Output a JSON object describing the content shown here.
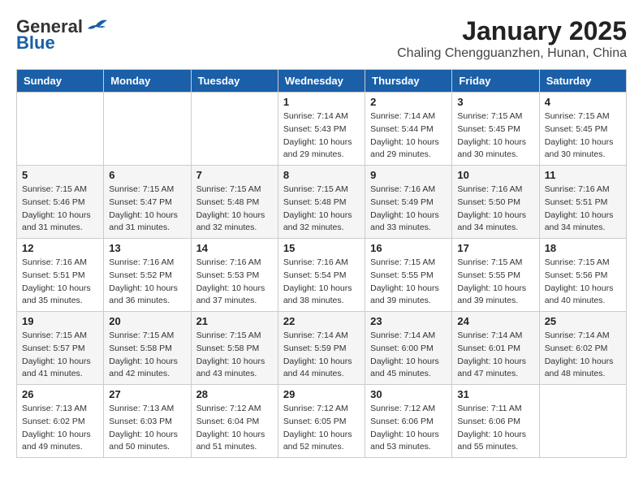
{
  "header": {
    "logo_general": "General",
    "logo_blue": "Blue",
    "title": "January 2025",
    "subtitle": "Chaling Chengguanzhen, Hunan, China"
  },
  "weekdays": [
    "Sunday",
    "Monday",
    "Tuesday",
    "Wednesday",
    "Thursday",
    "Friday",
    "Saturday"
  ],
  "weeks": [
    [
      {
        "day": "",
        "info": ""
      },
      {
        "day": "",
        "info": ""
      },
      {
        "day": "",
        "info": ""
      },
      {
        "day": "1",
        "info": "Sunrise: 7:14 AM\nSunset: 5:43 PM\nDaylight: 10 hours\nand 29 minutes."
      },
      {
        "day": "2",
        "info": "Sunrise: 7:14 AM\nSunset: 5:44 PM\nDaylight: 10 hours\nand 29 minutes."
      },
      {
        "day": "3",
        "info": "Sunrise: 7:15 AM\nSunset: 5:45 PM\nDaylight: 10 hours\nand 30 minutes."
      },
      {
        "day": "4",
        "info": "Sunrise: 7:15 AM\nSunset: 5:45 PM\nDaylight: 10 hours\nand 30 minutes."
      }
    ],
    [
      {
        "day": "5",
        "info": "Sunrise: 7:15 AM\nSunset: 5:46 PM\nDaylight: 10 hours\nand 31 minutes."
      },
      {
        "day": "6",
        "info": "Sunrise: 7:15 AM\nSunset: 5:47 PM\nDaylight: 10 hours\nand 31 minutes."
      },
      {
        "day": "7",
        "info": "Sunrise: 7:15 AM\nSunset: 5:48 PM\nDaylight: 10 hours\nand 32 minutes."
      },
      {
        "day": "8",
        "info": "Sunrise: 7:15 AM\nSunset: 5:48 PM\nDaylight: 10 hours\nand 32 minutes."
      },
      {
        "day": "9",
        "info": "Sunrise: 7:16 AM\nSunset: 5:49 PM\nDaylight: 10 hours\nand 33 minutes."
      },
      {
        "day": "10",
        "info": "Sunrise: 7:16 AM\nSunset: 5:50 PM\nDaylight: 10 hours\nand 34 minutes."
      },
      {
        "day": "11",
        "info": "Sunrise: 7:16 AM\nSunset: 5:51 PM\nDaylight: 10 hours\nand 34 minutes."
      }
    ],
    [
      {
        "day": "12",
        "info": "Sunrise: 7:16 AM\nSunset: 5:51 PM\nDaylight: 10 hours\nand 35 minutes."
      },
      {
        "day": "13",
        "info": "Sunrise: 7:16 AM\nSunset: 5:52 PM\nDaylight: 10 hours\nand 36 minutes."
      },
      {
        "day": "14",
        "info": "Sunrise: 7:16 AM\nSunset: 5:53 PM\nDaylight: 10 hours\nand 37 minutes."
      },
      {
        "day": "15",
        "info": "Sunrise: 7:16 AM\nSunset: 5:54 PM\nDaylight: 10 hours\nand 38 minutes."
      },
      {
        "day": "16",
        "info": "Sunrise: 7:15 AM\nSunset: 5:55 PM\nDaylight: 10 hours\nand 39 minutes."
      },
      {
        "day": "17",
        "info": "Sunrise: 7:15 AM\nSunset: 5:55 PM\nDaylight: 10 hours\nand 39 minutes."
      },
      {
        "day": "18",
        "info": "Sunrise: 7:15 AM\nSunset: 5:56 PM\nDaylight: 10 hours\nand 40 minutes."
      }
    ],
    [
      {
        "day": "19",
        "info": "Sunrise: 7:15 AM\nSunset: 5:57 PM\nDaylight: 10 hours\nand 41 minutes."
      },
      {
        "day": "20",
        "info": "Sunrise: 7:15 AM\nSunset: 5:58 PM\nDaylight: 10 hours\nand 42 minutes."
      },
      {
        "day": "21",
        "info": "Sunrise: 7:15 AM\nSunset: 5:58 PM\nDaylight: 10 hours\nand 43 minutes."
      },
      {
        "day": "22",
        "info": "Sunrise: 7:14 AM\nSunset: 5:59 PM\nDaylight: 10 hours\nand 44 minutes."
      },
      {
        "day": "23",
        "info": "Sunrise: 7:14 AM\nSunset: 6:00 PM\nDaylight: 10 hours\nand 45 minutes."
      },
      {
        "day": "24",
        "info": "Sunrise: 7:14 AM\nSunset: 6:01 PM\nDaylight: 10 hours\nand 47 minutes."
      },
      {
        "day": "25",
        "info": "Sunrise: 7:14 AM\nSunset: 6:02 PM\nDaylight: 10 hours\nand 48 minutes."
      }
    ],
    [
      {
        "day": "26",
        "info": "Sunrise: 7:13 AM\nSunset: 6:02 PM\nDaylight: 10 hours\nand 49 minutes."
      },
      {
        "day": "27",
        "info": "Sunrise: 7:13 AM\nSunset: 6:03 PM\nDaylight: 10 hours\nand 50 minutes."
      },
      {
        "day": "28",
        "info": "Sunrise: 7:12 AM\nSunset: 6:04 PM\nDaylight: 10 hours\nand 51 minutes."
      },
      {
        "day": "29",
        "info": "Sunrise: 7:12 AM\nSunset: 6:05 PM\nDaylight: 10 hours\nand 52 minutes."
      },
      {
        "day": "30",
        "info": "Sunrise: 7:12 AM\nSunset: 6:06 PM\nDaylight: 10 hours\nand 53 minutes."
      },
      {
        "day": "31",
        "info": "Sunrise: 7:11 AM\nSunset: 6:06 PM\nDaylight: 10 hours\nand 55 minutes."
      },
      {
        "day": "",
        "info": ""
      }
    ]
  ]
}
